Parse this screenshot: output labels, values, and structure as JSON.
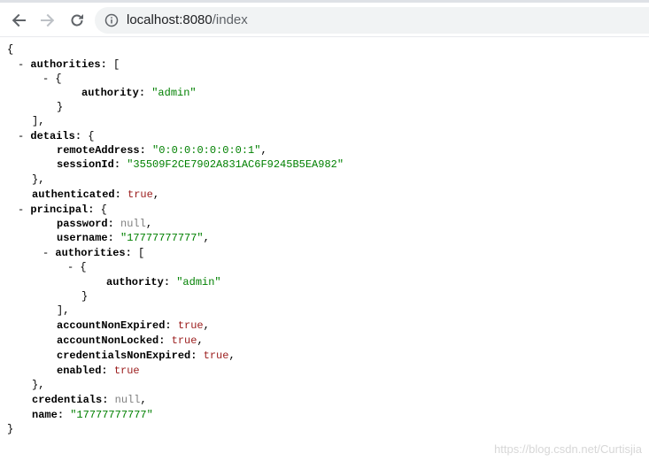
{
  "browser": {
    "url_host": "localhost:8080",
    "url_path": "/index",
    "back_icon": "arrow-left-icon",
    "forward_icon": "arrow-right-icon",
    "reload_icon": "reload-icon",
    "info_icon": "info-icon"
  },
  "json": {
    "open": "{",
    "close": "}",
    "k_authorities": "authorities",
    "k_authority": "authority",
    "v_admin": "\"admin\"",
    "k_details": "details",
    "k_remoteAddress": "remoteAddress",
    "v_remoteAddress": "\"0:0:0:0:0:0:0:1\"",
    "k_sessionId": "sessionId",
    "v_sessionId": "\"35509F2CE7902A831AC6F9245B5EA982\"",
    "k_authenticated": "authenticated",
    "v_true": "true",
    "k_principal": "principal",
    "k_password": "password",
    "v_null": "null",
    "k_username": "username",
    "v_username": "\"17777777777\"",
    "k_accountNonExpired": "accountNonExpired",
    "k_accountNonLocked": "accountNonLocked",
    "k_credentialsNonExpired": "credentialsNonExpired",
    "k_enabled": "enabled",
    "k_credentials": "credentials",
    "k_name": "name",
    "v_name": "\"17777777777\""
  },
  "watermark": "https://blog.csdn.net/Curtisjia"
}
